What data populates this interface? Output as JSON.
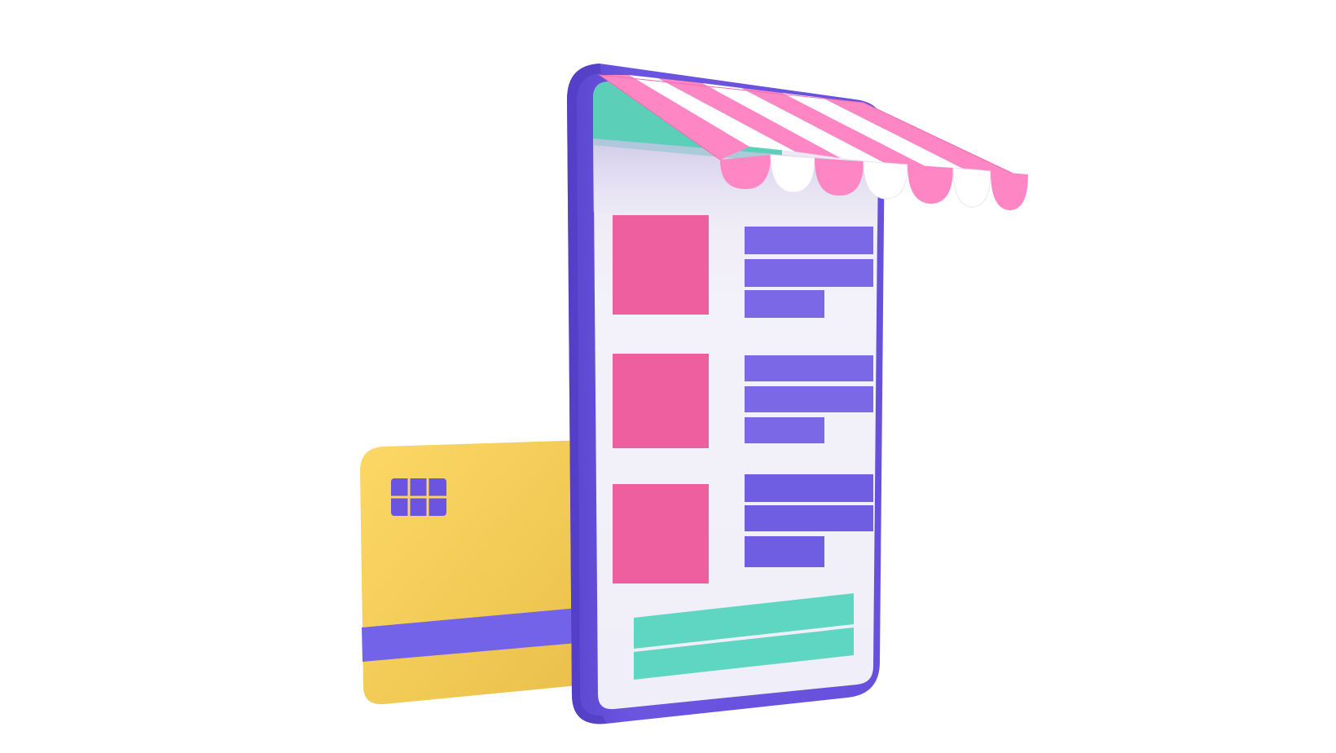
{
  "illustration": {
    "subject": "mobile-shop-phone-with-awning-and-credit-card",
    "colors": {
      "phone_frame": "#6b55e0",
      "phone_frame_dark": "#5a45cc",
      "screen": "#f1eff7",
      "screen_top_band": "#5ccfb9",
      "product_thumbnail": "#ee5fa0",
      "text_bar": "#7a68e6",
      "checkout_bar": "#5fd6c1",
      "awning_pink": "#ff86c4",
      "awning_white": "#ffffff",
      "card": "#fcd35d",
      "card_stripe": "#7363e8",
      "card_chip": "#6b55e0"
    },
    "product_rows": [
      {
        "thumbnail": "pink-square",
        "bars": [
          "long",
          "long",
          "short"
        ]
      },
      {
        "thumbnail": "pink-square",
        "bars": [
          "long",
          "long",
          "short"
        ]
      },
      {
        "thumbnail": "pink-square",
        "bars": [
          "long",
          "long",
          "short"
        ]
      }
    ],
    "checkout_buttons": 2,
    "awning_scallops": 7,
    "card_chip_cells": 6
  }
}
